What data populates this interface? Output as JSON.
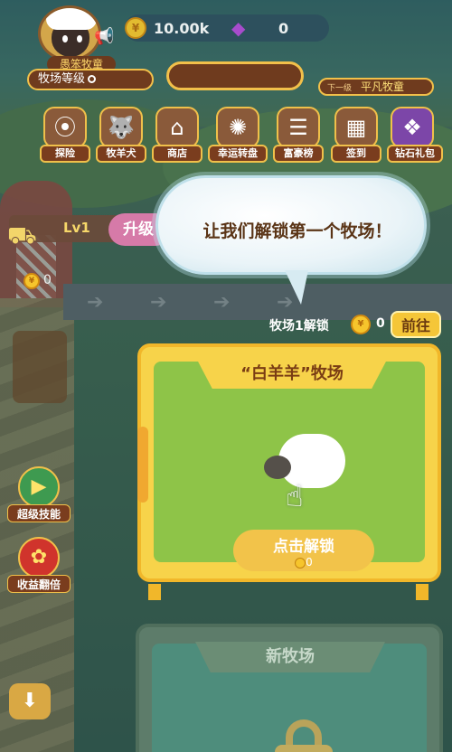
{
  "header": {
    "coins": "10.00k",
    "gems": "0",
    "player_title": "愚笨牧童",
    "level_label": "牧场等级",
    "next_level_prefix": "下一级",
    "next_level_title": "平凡牧童"
  },
  "menu": [
    {
      "label": "探险",
      "icon": "adventure-icon"
    },
    {
      "label": "牧羊犬",
      "icon": "dog-icon"
    },
    {
      "label": "商店",
      "icon": "shop-icon"
    },
    {
      "label": "幸运转盘",
      "icon": "wheel-icon"
    },
    {
      "label": "富豪榜",
      "icon": "podium-icon"
    },
    {
      "label": "签到",
      "icon": "calendar-icon"
    },
    {
      "label": "钻石礼包",
      "icon": "treasure-icon"
    }
  ],
  "production": {
    "level": "Lv1",
    "upgrade_label": "升级",
    "stored_coins": "0"
  },
  "bubble": {
    "text": "让我们解锁第一个牧场！"
  },
  "unlock": {
    "text": "牧场1解锁",
    "cost": "0",
    "goto_label": "前往"
  },
  "ranch_card": {
    "title": "“白羊羊”牧场",
    "button_label": "点击解锁",
    "button_cost": "0"
  },
  "side": {
    "skill_label": "超级技能",
    "double_label": "收益翻倍"
  },
  "new_ranch": {
    "title": "新牧场"
  },
  "colors": {
    "gold": "#f7d34a",
    "brown": "#6f3b1e",
    "grass": "#8ec448"
  }
}
